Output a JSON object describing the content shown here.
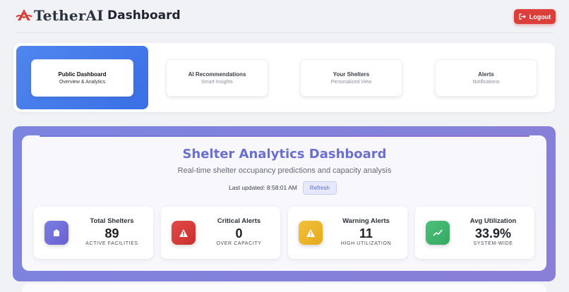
{
  "header": {
    "brand": "TetherAI",
    "title": "Dashboard",
    "logout_label": "Logout"
  },
  "tabs": [
    {
      "title": "Public Dashboard",
      "subtitle": "Overview & Analytics",
      "active": true
    },
    {
      "title": "AI Recommendations",
      "subtitle": "Smart Insights",
      "active": false
    },
    {
      "title": "Your Shelters",
      "subtitle": "Personalized View",
      "active": false
    },
    {
      "title": "Alerts",
      "subtitle": "Notifications",
      "active": false
    }
  ],
  "analytics": {
    "title": "Shelter Analytics Dashboard",
    "subtitle": "Real-time shelter occupancy predictions and capacity analysis",
    "last_updated": "Last updated: 8:58:01 AM",
    "refresh_label": "Refresh"
  },
  "stats": [
    {
      "label": "Total Shelters",
      "value": "89",
      "sub": "ACTIVE FACILITIES",
      "icon": "shelter-icon",
      "color": "#7078e0"
    },
    {
      "label": "Critical Alerts",
      "value": "0",
      "sub": "OVER CAPACITY",
      "icon": "warning-icon",
      "color": "#d63b38"
    },
    {
      "label": "Warning Alerts",
      "value": "11",
      "sub": "HIGH UTILIZATION",
      "icon": "warning-icon",
      "color": "#efb52b"
    },
    {
      "label": "Avg Utilization",
      "value": "33.9%",
      "sub": "SYSTEM-WIDE",
      "icon": "trend-up-icon",
      "color": "#41b66e"
    }
  ],
  "colors": {
    "accent": "#3f75e8",
    "logout": "#dc3e3a",
    "title": "#6a6fd0"
  }
}
